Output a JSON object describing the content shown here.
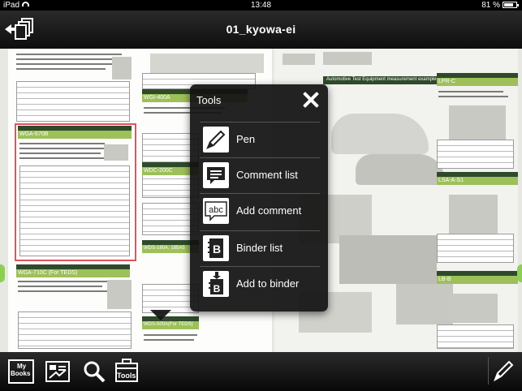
{
  "status_bar": {
    "device": "iPad",
    "time": "13:48",
    "battery": "81 %"
  },
  "toolbar": {
    "title": "01_kyowa-ei"
  },
  "tools_menu": {
    "title": "Tools",
    "items": [
      {
        "label": "Pen",
        "icon": "pen-icon"
      },
      {
        "label": "Comment list",
        "icon": "comment-list-icon"
      },
      {
        "label": "Add comment",
        "icon": "abc-comment-icon",
        "icon_text": "abc"
      },
      {
        "label": "Binder list",
        "icon": "binder-list-icon",
        "icon_text": "B"
      },
      {
        "label": "Add to binder",
        "icon": "add-to-binder-icon",
        "icon_text": "B"
      }
    ]
  },
  "bottom_bar": {
    "my_books_label_1": "My",
    "my_books_label_2": "Books",
    "tools_label": "Tools"
  },
  "document_text": {
    "left_heading_1": "Instrumentation Amplifier",
    "left_heading_1b": "WGA-670B",
    "left_heading_2": "Instrumentation Amplifier",
    "left_heading_2b": "WGA-710C (For TEDS)",
    "left_heading_3": "Instrumentation Amplifier",
    "left_heading_3b": "WGA-100B",
    "mid_heading_1": "Instrumentation Amplifier",
    "mid_heading_1b": "WGI-400A",
    "mid_heading_2": "Instrumentation Conditioners",
    "mid_heading_2b": "WDC-200C",
    "mid_heading_3": "Compact Digital Indicators",
    "mid_heading_3b": "WDS-180A, 185A5",
    "mid_heading_4": "Sensor Checker",
    "mid_heading_4b": "WDS-500A(For TEDS)",
    "center_banner": "Automotive Test Equipment measurement example",
    "right_heading_1": "Pedal Force Transducer",
    "right_heading_1b": "LPR-C",
    "right_heading_2": "Change Lever Operating Force Transducer",
    "right_heading_2b": "LSA-A-S1",
    "right_heading_3": "Hand Brake Force Transducer",
    "right_heading_3b": "LB-B"
  },
  "colors": {
    "green_band": "#9dc05a",
    "dark_band": "#2f4a2a",
    "highlight": "#e15360",
    "handle": "#8ecf52"
  }
}
